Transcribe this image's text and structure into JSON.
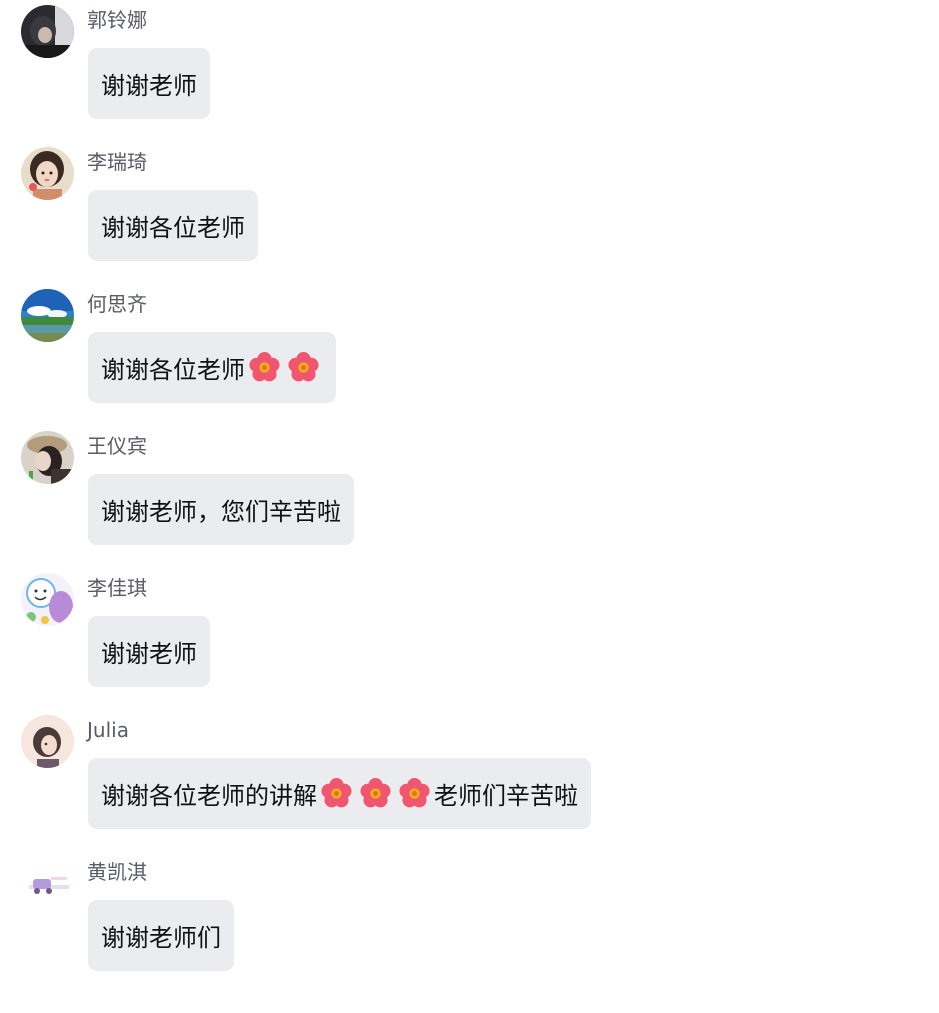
{
  "messages": [
    {
      "sender": "郭铃娜",
      "avatar": "avatar-dark-portrait",
      "text": "谢谢老师"
    },
    {
      "sender": "李瑞琦",
      "avatar": "avatar-illustrated-girl",
      "text": "谢谢各位老师"
    },
    {
      "sender": "何思齐",
      "avatar": "avatar-landscape",
      "text": "谢谢各位老师",
      "suffix_flowers": 2
    },
    {
      "sender": "王仪宾",
      "avatar": "avatar-cap-portrait",
      "text": "谢谢老师，您们辛苦啦"
    },
    {
      "sender": "李佳琪",
      "avatar": "avatar-cartoon",
      "text": "谢谢老师"
    },
    {
      "sender": "Julia",
      "avatar": "avatar-anime-girl",
      "text_before": "谢谢各位老师的讲解",
      "mid_flowers": 3,
      "text_after": "老师们辛苦啦"
    },
    {
      "sender": "黄凯淇",
      "avatar": "avatar-car-sticker",
      "text": "谢谢老师们"
    }
  ],
  "colors": {
    "bubble": "#ebecf0",
    "name": "#585c66",
    "text": "#111111",
    "flower_petal": "#f0566f",
    "flower_center": "#f2b01e"
  },
  "icons": {
    "flower": "flower-emoji-icon"
  }
}
